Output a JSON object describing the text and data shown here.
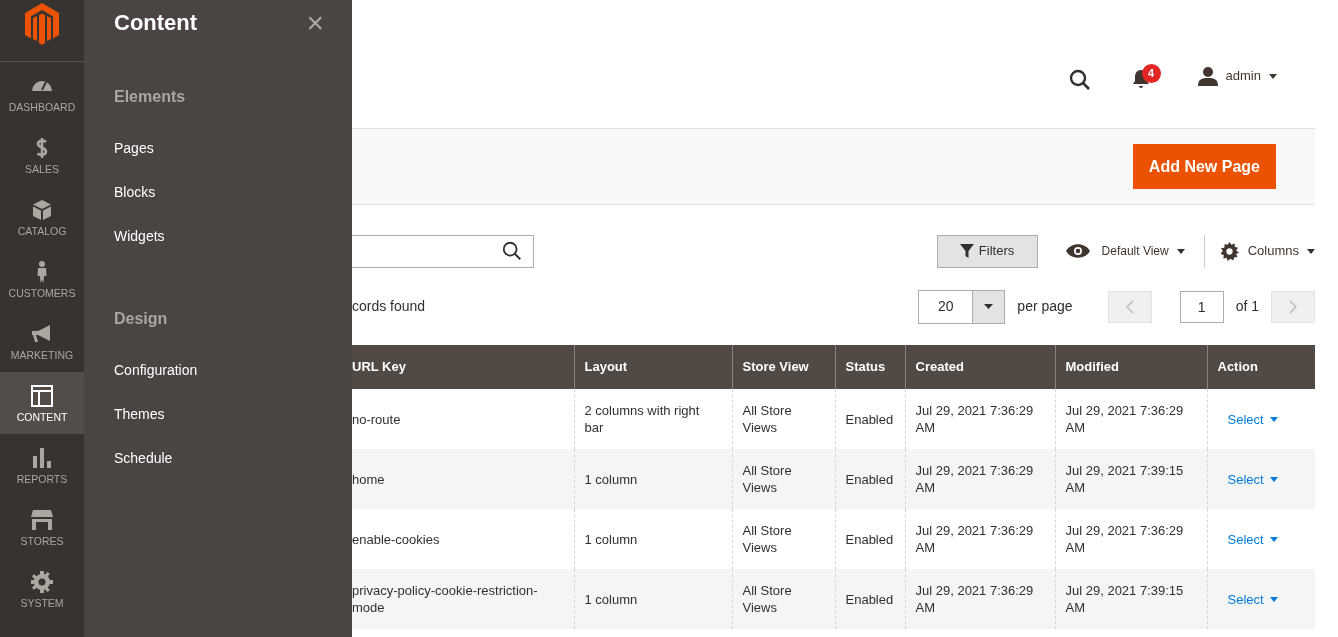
{
  "sidebar": {
    "items": [
      {
        "label": "DASHBOARD",
        "selected": false
      },
      {
        "label": "SALES",
        "selected": false
      },
      {
        "label": "CATALOG",
        "selected": false
      },
      {
        "label": "CUSTOMERS",
        "selected": false
      },
      {
        "label": "MARKETING",
        "selected": false
      },
      {
        "label": "CONTENT",
        "selected": true
      },
      {
        "label": "REPORTS",
        "selected": false
      },
      {
        "label": "STORES",
        "selected": false
      },
      {
        "label": "SYSTEM",
        "selected": false
      }
    ]
  },
  "flyout": {
    "title": "Content",
    "close": "×",
    "sections": [
      {
        "heading": "Elements",
        "items": [
          "Pages",
          "Blocks",
          "Widgets"
        ]
      },
      {
        "heading": "Design",
        "items": [
          "Configuration",
          "Themes",
          "Schedule"
        ]
      }
    ]
  },
  "header": {
    "notifications": "4",
    "user": "admin"
  },
  "action_bar": {
    "button": "Add New Page"
  },
  "toolbar": {
    "filters": "Filters",
    "view": "Default View",
    "columns": "Columns",
    "records": "cords found",
    "per_page_value": "20",
    "per_page_label": "per page",
    "page": "1",
    "page_total": "of 1"
  },
  "table": {
    "columns": [
      "URL Key",
      "Layout",
      "Store View",
      "Status",
      "Created",
      "Modified",
      "Action"
    ],
    "rows": [
      [
        "no-route",
        "2 columns with right bar",
        "All Store Views",
        "Enabled",
        "Jul 29, 2021 7:36:29 AM",
        "Jul 29, 2021 7:36:29 AM",
        "Select"
      ],
      [
        "home",
        "1 column",
        "All Store Views",
        "Enabled",
        "Jul 29, 2021 7:36:29 AM",
        "Jul 29, 2021 7:39:15 AM",
        "Select"
      ],
      [
        "enable-cookies",
        "1 column",
        "All Store Views",
        "Enabled",
        "Jul 29, 2021 7:36:29 AM",
        "Jul 29, 2021 7:36:29 AM",
        "Select"
      ],
      [
        "privacy-policy-cookie-restriction-mode",
        "1 column",
        "All Store Views",
        "Enabled",
        "Jul 29, 2021 7:36:29 AM",
        "Jul 29, 2021 7:39:15 AM",
        "Select"
      ]
    ]
  }
}
